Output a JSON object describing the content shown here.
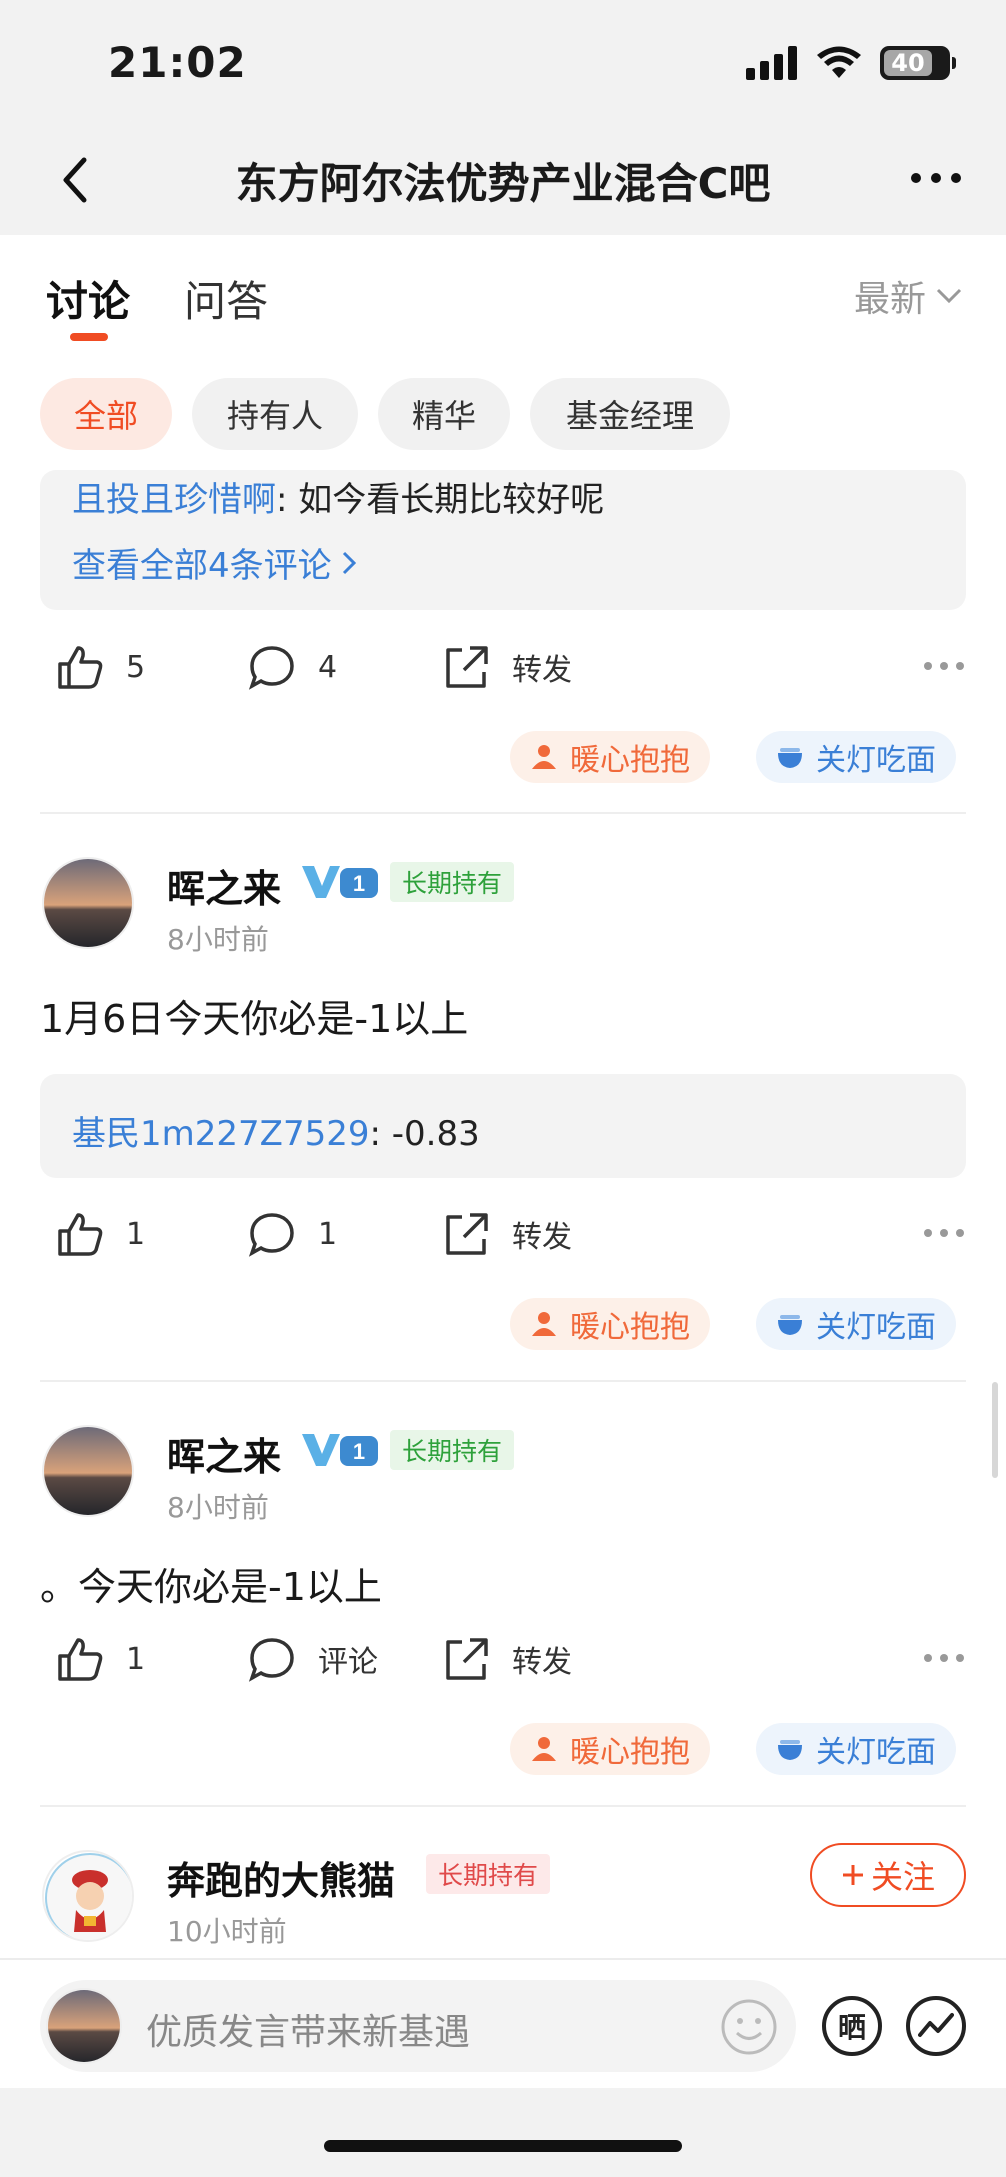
{
  "status_bar": {
    "time": "21:02",
    "battery": "40"
  },
  "nav": {
    "title": "东方阿尔法优势产业混合C吧"
  },
  "tabs": [
    {
      "label": "讨论"
    },
    {
      "label": "问答"
    }
  ],
  "sort_label": "最新",
  "filter_chips": [
    "全部",
    "持有人",
    "精华",
    "基金经理"
  ],
  "post0": {
    "comment_name": "且投且珍惜啊",
    "comment_text": ": 如今看长期比较好呢",
    "view_all": "查看全部4条评论",
    "likes": "5",
    "comments": "4",
    "share": "转发"
  },
  "reactions": {
    "warm": "暖心抱抱",
    "lights": "关灯吃面"
  },
  "post1": {
    "user": "晖之来",
    "level": "1",
    "tag": "长期持有",
    "time": "8小时前",
    "text": "1月6日今天你必是-1以上",
    "comment_name": "基民1m227Z7529",
    "comment_text": ": -0.83",
    "likes": "1",
    "comments": "1",
    "share": "转发"
  },
  "post2": {
    "user": "晖之来",
    "level": "1",
    "tag": "长期持有",
    "time": "8小时前",
    "text": "。今天你必是-1以上",
    "likes": "1",
    "comments": "评论",
    "share": "转发"
  },
  "post3": {
    "user": "奔跑的大熊猫",
    "tag": "长期持有",
    "time": "10小时前",
    "follow": "关注"
  },
  "input": {
    "placeholder": "优质发言带来新基遇",
    "show_label": "晒"
  },
  "colors": {
    "accent": "#f04c23",
    "link": "#3a7fd6",
    "green_tag": "#2ea13b"
  }
}
